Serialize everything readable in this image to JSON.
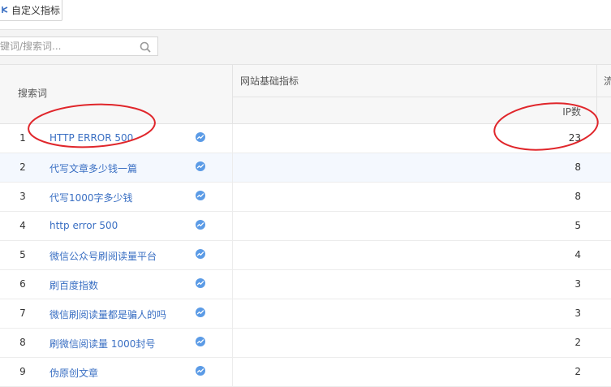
{
  "toolbar": {
    "custom_metrics_label": "自定义指标"
  },
  "search": {
    "placeholder": "键词/搜索词..."
  },
  "table": {
    "col_keyword": "搜索词",
    "group_basic": "网站基础指标",
    "group_next": "流",
    "col_ip": "IP数",
    "rows": [
      {
        "index": "1",
        "keyword": "HTTP ERROR 500",
        "ip": "23"
      },
      {
        "index": "2",
        "keyword": "代写文章多少钱一篇",
        "ip": "8"
      },
      {
        "index": "3",
        "keyword": "代写1000字多少钱",
        "ip": "8"
      },
      {
        "index": "4",
        "keyword": "http error 500",
        "ip": "5"
      },
      {
        "index": "5",
        "keyword": "微信公众号刷阅读量平台",
        "ip": "4"
      },
      {
        "index": "6",
        "keyword": "刷百度指数",
        "ip": "3"
      },
      {
        "index": "7",
        "keyword": "微信刷阅读量都是骗人的吗",
        "ip": "3"
      },
      {
        "index": "8",
        "keyword": "刷微信阅读量 1000封号",
        "ip": "2"
      },
      {
        "index": "9",
        "keyword": "伪原创文章",
        "ip": "2"
      }
    ]
  },
  "colors": {
    "link": "#3a6fc3",
    "annotation": "#e0262b",
    "trend_icon": "#5b9be6"
  },
  "icons": {
    "trend": "trend-chart-icon",
    "search": "search-icon",
    "custom": "custom-metrics-icon"
  }
}
